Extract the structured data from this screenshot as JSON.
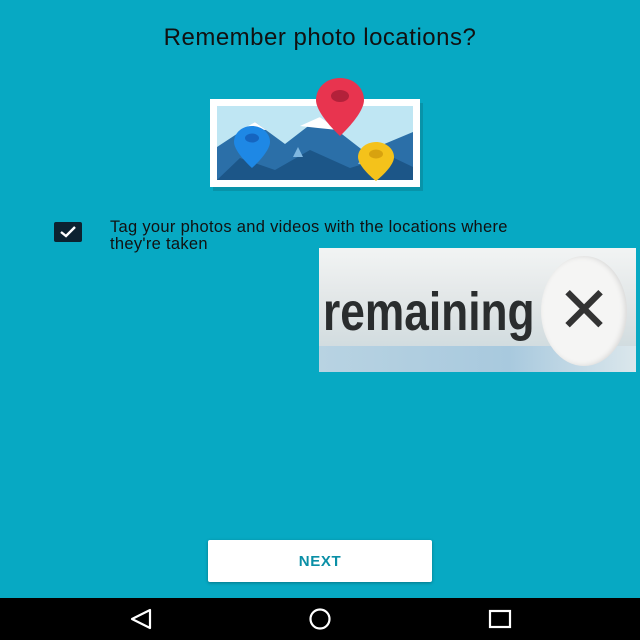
{
  "dialog": {
    "title": "Remember photo locations?",
    "option_text": "Tag your photos and videos with the locations where they're taken",
    "option_checked": true,
    "next_label": "NEXT"
  },
  "overlay_ad": {
    "text": "remaining",
    "close_glyph": "✕"
  },
  "navbar": {
    "back_icon": "back-triangle-icon",
    "home_icon": "home-circle-icon",
    "recents_icon": "recents-square-icon"
  },
  "colors": {
    "background": "#07a9c3",
    "button_text": "#0a8fa6",
    "pin_red": "#e8344f",
    "pin_blue": "#1e88e5",
    "pin_yellow": "#f4c21b"
  }
}
